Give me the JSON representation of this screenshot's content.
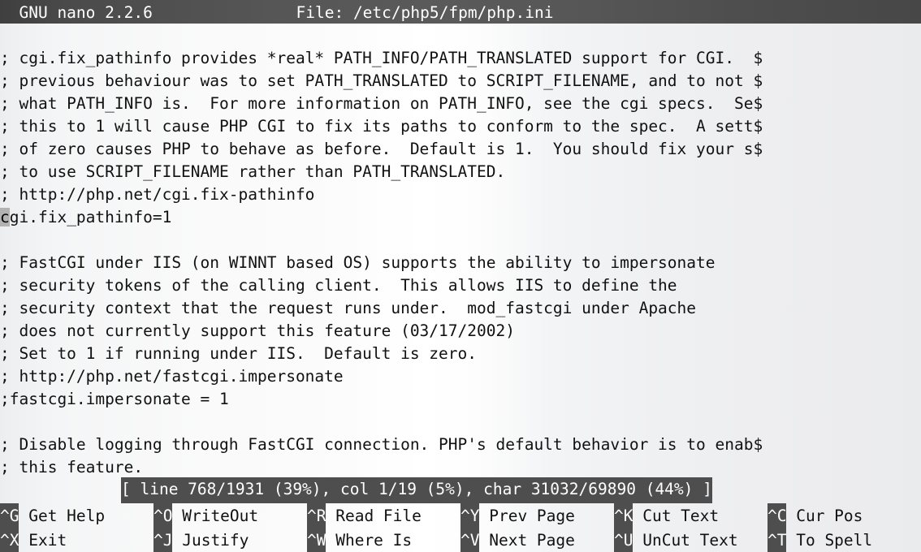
{
  "window": {
    "app_name": "GNU nano",
    "version": "2.2.6",
    "title_left": "  GNU nano 2.2.6",
    "file_label": "File: /etc/php5/fpm/php.ini",
    "file_path": "/etc/php5/fpm/php.ini"
  },
  "editor": {
    "lines": [
      "",
      "; cgi.fix_pathinfo provides *real* PATH_INFO/PATH_TRANSLATED support for CGI.  $",
      "; previous behaviour was to set PATH_TRANSLATED to SCRIPT_FILENAME, and to not $",
      "; what PATH_INFO is.  For more information on PATH_INFO, see the cgi specs.  Se$",
      "; this to 1 will cause PHP CGI to fix its paths to conform to the spec.  A sett$",
      "; of zero causes PHP to behave as before.  Default is 1.  You should fix your s$",
      "; to use SCRIPT_FILENAME rather than PATH_TRANSLATED.",
      "; http://php.net/cgi.fix-pathinfo",
      "cgi.fix_pathinfo=1",
      "",
      "; FastCGI under IIS (on WINNT based OS) supports the ability to impersonate",
      "; security tokens of the calling client.  This allows IIS to define the",
      "; security context that the request runs under.  mod_fastcgi under Apache",
      "; does not currently support this feature (03/17/2002)",
      "; Set to 1 if running under IIS.  Default is zero.",
      "; http://php.net/fastcgi.impersonate",
      ";fastcgi.impersonate = 1",
      "",
      "; Disable logging through FastCGI connection. PHP's default behavior is to enab$",
      "; this feature."
    ],
    "cursor": {
      "line_index": 8,
      "column_index": 0,
      "char": "c",
      "line_before": "",
      "line_after": "gi.fix_pathinfo=1"
    }
  },
  "status": {
    "text": "[ line 768/1931 (39%), col 1/19 (5%), char 31032/69890 (44%) ]",
    "line_current": "768",
    "line_total": "1931",
    "line_percent": "39%",
    "col_current": "1",
    "col_total": "19",
    "col_percent": "5%",
    "char_current": "31032",
    "char_total": "69890",
    "char_percent": "44%"
  },
  "shortcuts": {
    "row1": [
      {
        "key": "^G",
        "label": " Get Help"
      },
      {
        "key": "^O",
        "label": " WriteOut"
      },
      {
        "key": "^R",
        "label": " Read File"
      },
      {
        "key": "^Y",
        "label": " Prev Page"
      },
      {
        "key": "^K",
        "label": " Cut Text"
      },
      {
        "key": "^C",
        "label": " Cur Pos"
      }
    ],
    "row2": [
      {
        "key": "^X",
        "label": " Exit"
      },
      {
        "key": "^J",
        "label": " Justify"
      },
      {
        "key": "^W",
        "label": " Where Is"
      },
      {
        "key": "^V",
        "label": " Next Page"
      },
      {
        "key": "^U",
        "label": " UnCut Text"
      },
      {
        "key": "^T",
        "label": " To Spell"
      }
    ]
  },
  "colors": {
    "background": "#f4f5f6",
    "foreground": "#111111",
    "inverse_background": "#4e4e4e",
    "inverse_foreground": "#ffffff",
    "cursor_background": "#b2b2b2"
  }
}
